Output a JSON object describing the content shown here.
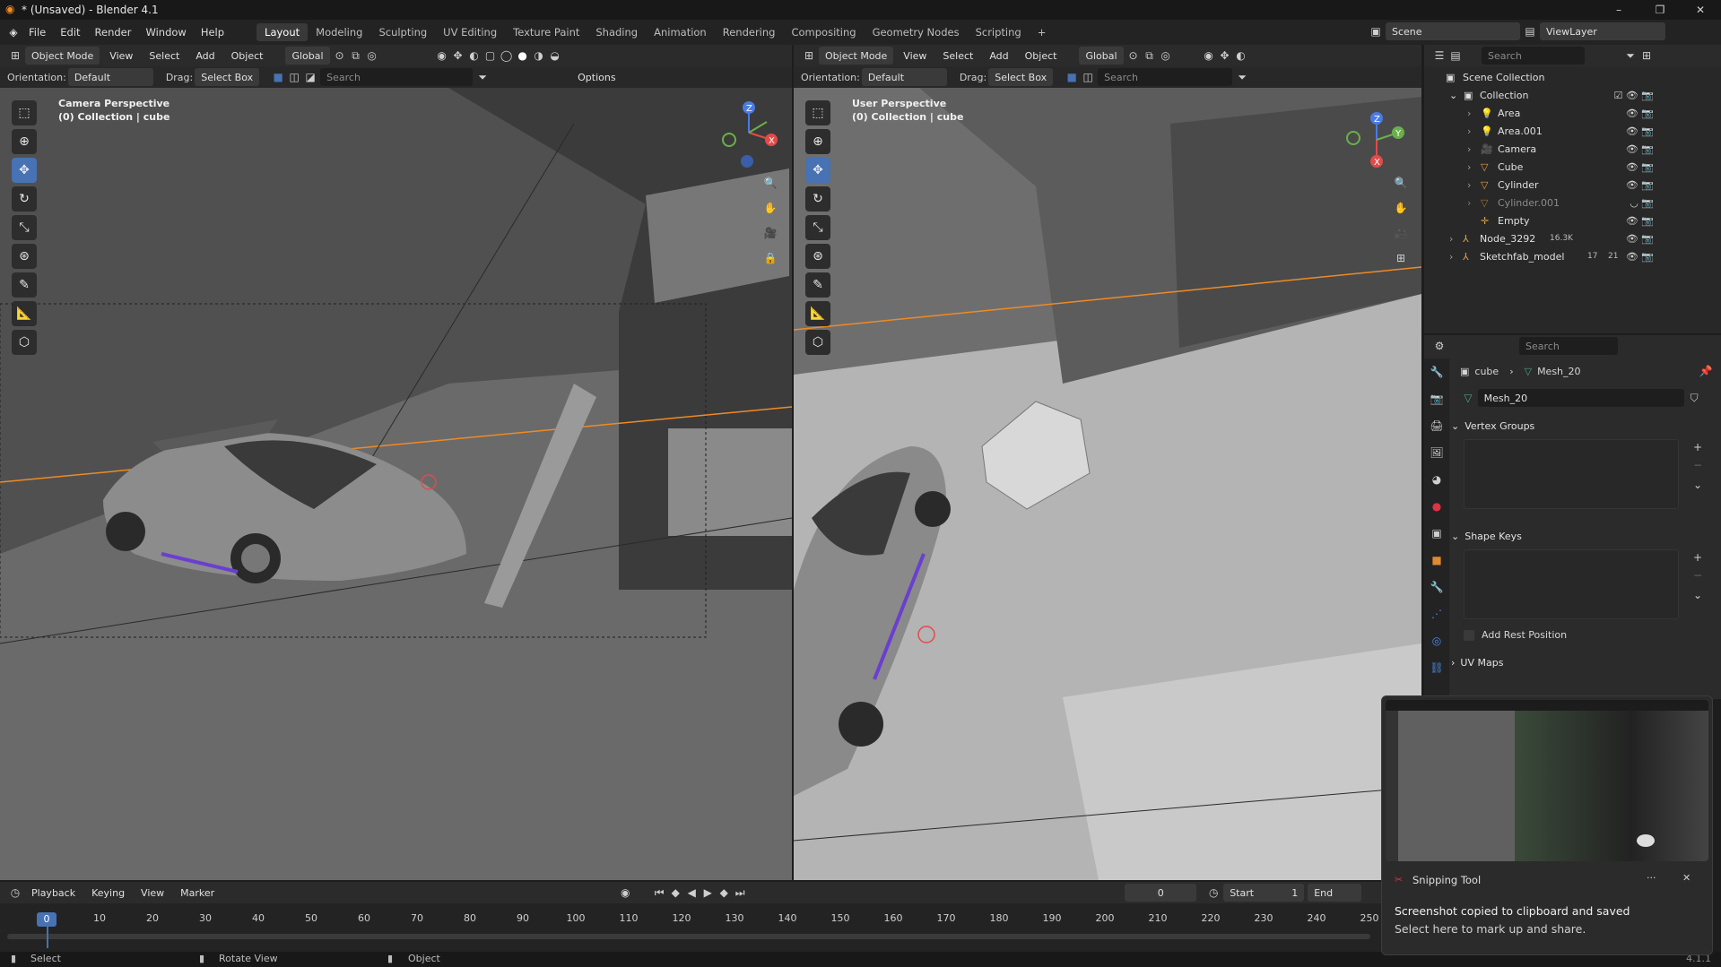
{
  "window": {
    "title": "* (Unsaved) - Blender 4.1",
    "minimize": "–",
    "maximize": "❐",
    "close": "✕"
  },
  "menu": [
    "File",
    "Edit",
    "Render",
    "Window",
    "Help"
  ],
  "workspaces": [
    "Layout",
    "Modeling",
    "Sculpting",
    "UV Editing",
    "Texture Paint",
    "Shading",
    "Animation",
    "Rendering",
    "Compositing",
    "Geometry Nodes",
    "Scripting",
    "+"
  ],
  "scene": {
    "name": "Scene",
    "view_layer": "ViewLayer"
  },
  "viewport_left": {
    "mode": "Object Mode",
    "menus": [
      "View",
      "Select",
      "Add",
      "Object"
    ],
    "transform": "Global",
    "orientation_label": "Orientation:",
    "orientation": "Default",
    "drag_label": "Drag:",
    "drag": "Select Box",
    "search_placeholder": "Search",
    "options": "Options",
    "perspective": "Camera Perspective",
    "collection": "(0) Collection | cube"
  },
  "viewport_right": {
    "mode": "Object Mode",
    "menus": [
      "View",
      "Select",
      "Add",
      "Object"
    ],
    "transform": "Global",
    "orientation_label": "Orientation:",
    "orientation": "Default",
    "drag_label": "Drag:",
    "drag": "Select Box",
    "search_placeholder": "Search",
    "perspective": "User Perspective",
    "collection": "(0) Collection | cube"
  },
  "outliner": {
    "search_placeholder": "Search",
    "root": "Scene Collection",
    "collection": "Collection",
    "items": [
      "Area",
      "Area.001",
      "Camera",
      "Cube",
      "Cylinder",
      "Cylinder.001",
      "Empty"
    ],
    "nodes": [
      "Node_3292",
      "Sketchfab_model"
    ],
    "node_badge": "16.3K",
    "sketch_badges": [
      "17",
      "21"
    ]
  },
  "properties": {
    "search_placeholder": "Search",
    "object": "cube",
    "mesh": "Mesh_20",
    "datablock": "Mesh_20",
    "panels": {
      "vertex_groups": "Vertex Groups",
      "shape_keys": "Shape Keys",
      "add_rest": "Add Rest Position",
      "uv_maps": "UV Maps"
    }
  },
  "timeline": {
    "menus": [
      "Playback",
      "Keying",
      "View",
      "Marker"
    ],
    "current_frame": "0",
    "start_label": "Start",
    "start": "1",
    "end_label": "End",
    "ticks": [
      "0",
      "10",
      "20",
      "30",
      "40",
      "50",
      "60",
      "70",
      "80",
      "90",
      "100",
      "110",
      "120",
      "130",
      "140",
      "150",
      "160",
      "170",
      "180",
      "190",
      "200",
      "210",
      "220",
      "230",
      "240",
      "250"
    ]
  },
  "status": {
    "select": "Select",
    "rotate": "Rotate View",
    "object": "Object",
    "version": "4.1.1"
  },
  "notification": {
    "app": "Snipping Tool",
    "more": "···",
    "close": "✕",
    "line1": "Screenshot copied to clipboard and saved",
    "line2": "Select here to mark up and share."
  },
  "gizmo": {
    "x": "X",
    "y": "Y",
    "z": "Z"
  },
  "colors": {
    "accent": "#4772b3",
    "selection": "#f08a24",
    "purple": "#6a3fd0"
  }
}
